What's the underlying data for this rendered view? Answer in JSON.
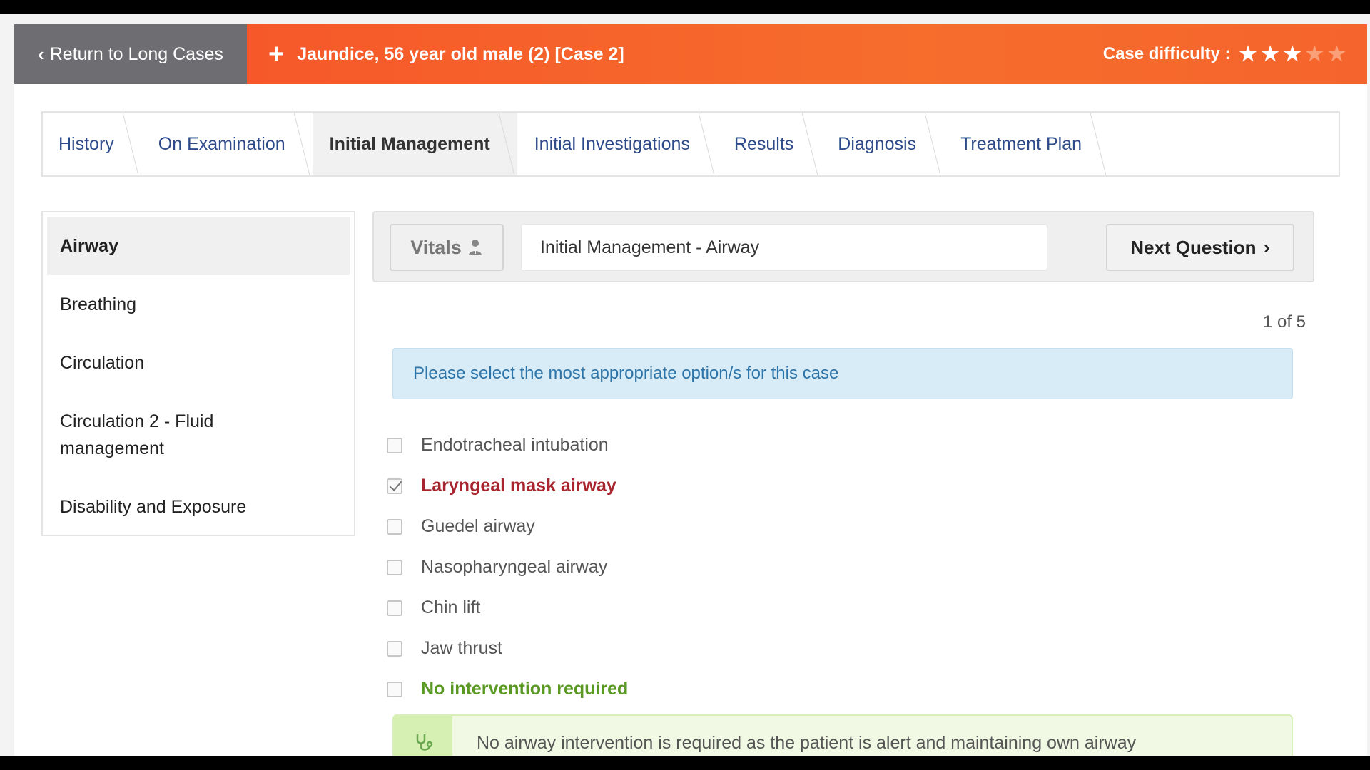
{
  "header": {
    "back_label": "Return to Long Cases",
    "case_title": "Jaundice, 56 year old male (2) [Case 2]",
    "difficulty_label": "Case difficulty :",
    "difficulty_rating": 3,
    "difficulty_max": 5,
    "accent_color": "#f6582a"
  },
  "tabs": [
    {
      "label": "History",
      "active": false
    },
    {
      "label": "On Examination",
      "active": false
    },
    {
      "label": "Initial Management",
      "active": true
    },
    {
      "label": "Initial Investigations",
      "active": false
    },
    {
      "label": "Results",
      "active": false
    },
    {
      "label": "Diagnosis",
      "active": false
    },
    {
      "label": "Treatment Plan",
      "active": false
    }
  ],
  "sidebar": {
    "items": [
      {
        "label": "Airway",
        "active": true
      },
      {
        "label": "Breathing",
        "active": false
      },
      {
        "label": "Circulation",
        "active": false
      },
      {
        "label": "Circulation 2 - Fluid management",
        "active": false
      },
      {
        "label": "Disability and Exposure",
        "active": false
      }
    ]
  },
  "question": {
    "vitals_label": "Vitals",
    "title": "Initial Management - Airway",
    "next_label": "Next Question",
    "counter": "1 of 5",
    "instruction": "Please select the most appropriate option/s for this case"
  },
  "options": [
    {
      "label": "Endotracheal intubation",
      "checked": false,
      "state": "normal"
    },
    {
      "label": "Laryngeal mask airway",
      "checked": true,
      "state": "wrong"
    },
    {
      "label": "Guedel airway",
      "checked": false,
      "state": "normal"
    },
    {
      "label": "Nasopharyngeal airway",
      "checked": false,
      "state": "normal"
    },
    {
      "label": "Chin lift",
      "checked": false,
      "state": "normal"
    },
    {
      "label": "Jaw thrust",
      "checked": false,
      "state": "normal"
    },
    {
      "label": "No intervention required",
      "checked": false,
      "state": "correct"
    }
  ],
  "feedback": {
    "icon": "stethoscope-icon",
    "text": "No airway intervention is required as the patient is alert and maintaining own airway"
  }
}
